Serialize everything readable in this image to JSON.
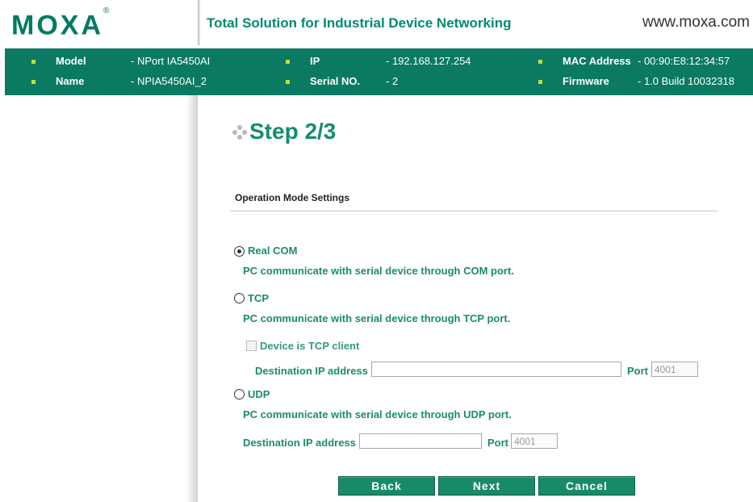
{
  "header": {
    "logo": "MOXA",
    "logo_mark": "®",
    "tagline": "Total Solution for Industrial Device Networking",
    "website": "www.moxa.com"
  },
  "device_info": {
    "model": {
      "label": "Model",
      "value": "- NPort IA5450AI"
    },
    "name": {
      "label": "Name",
      "value": "- NPIA5450AI_2"
    },
    "ip": {
      "label": "IP",
      "value": "- 192.168.127.254"
    },
    "serial": {
      "label": "Serial NO.",
      "value": "- 2"
    },
    "mac": {
      "label": "MAC Address",
      "value": "- 00:90:E8:12:34:57"
    },
    "firmware": {
      "label": "Firmware",
      "value": "- 1.0 Build 10032318"
    }
  },
  "colors": {
    "brand_green": "#0a7a63",
    "text_green": "#1a8c6e",
    "bullet": "#c9d93a"
  },
  "page": {
    "step_title": "Step 2/3",
    "section_title": "Operation Mode Settings"
  },
  "modes": {
    "selected": "real_com",
    "real_com": {
      "label": "Real COM",
      "description": "PC communicate with serial device through COM port."
    },
    "tcp": {
      "label": "TCP",
      "description": "PC communicate with serial device through TCP port.",
      "client_checkbox_label": "Device is TCP client",
      "client_checked": false,
      "dest_ip_label": "Destination IP address",
      "dest_ip_value": "",
      "port_label": "Port",
      "port_value": "4001"
    },
    "udp": {
      "label": "UDP",
      "description": "PC communicate with serial device through UDP port.",
      "dest_ip_label": "Destination IP address",
      "dest_ip_value": "",
      "port_label": "Port",
      "port_value": "4001"
    }
  },
  "buttons": {
    "back": "Back",
    "next": "Next",
    "cancel": "Cancel"
  }
}
